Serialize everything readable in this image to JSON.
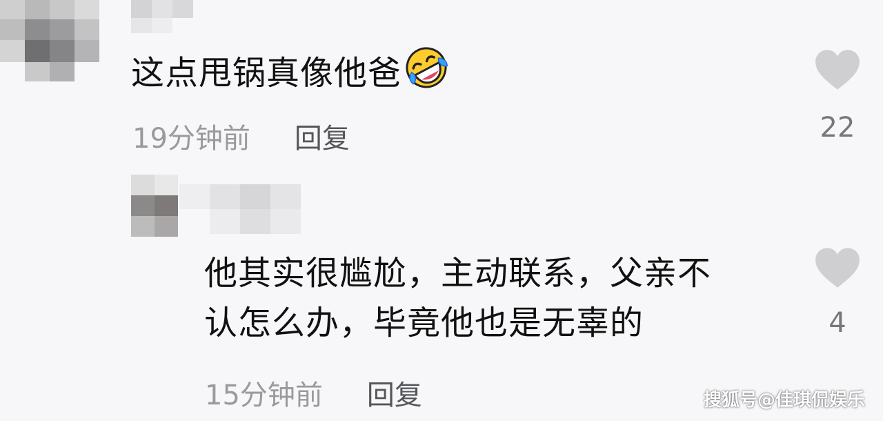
{
  "comments": [
    {
      "text": "这点甩锅真像他爸",
      "emoji": "rolling-on-floor-laughing",
      "time": "19分钟前",
      "reply_label": "回复",
      "likes": "22"
    },
    {
      "text_line1": "他其实很尴尬，主动联系，父亲不",
      "text_line2": "认怎么办，毕竟他也是无辜的",
      "time": "15分钟前",
      "reply_label": "回复",
      "likes": "4"
    }
  ],
  "watermark": "搜狐号@佳琪侃娱乐",
  "colors": {
    "background": "#f7f7f9",
    "text": "#111111",
    "meta": "#9a9a9e",
    "heart": "#cfcfd2"
  }
}
